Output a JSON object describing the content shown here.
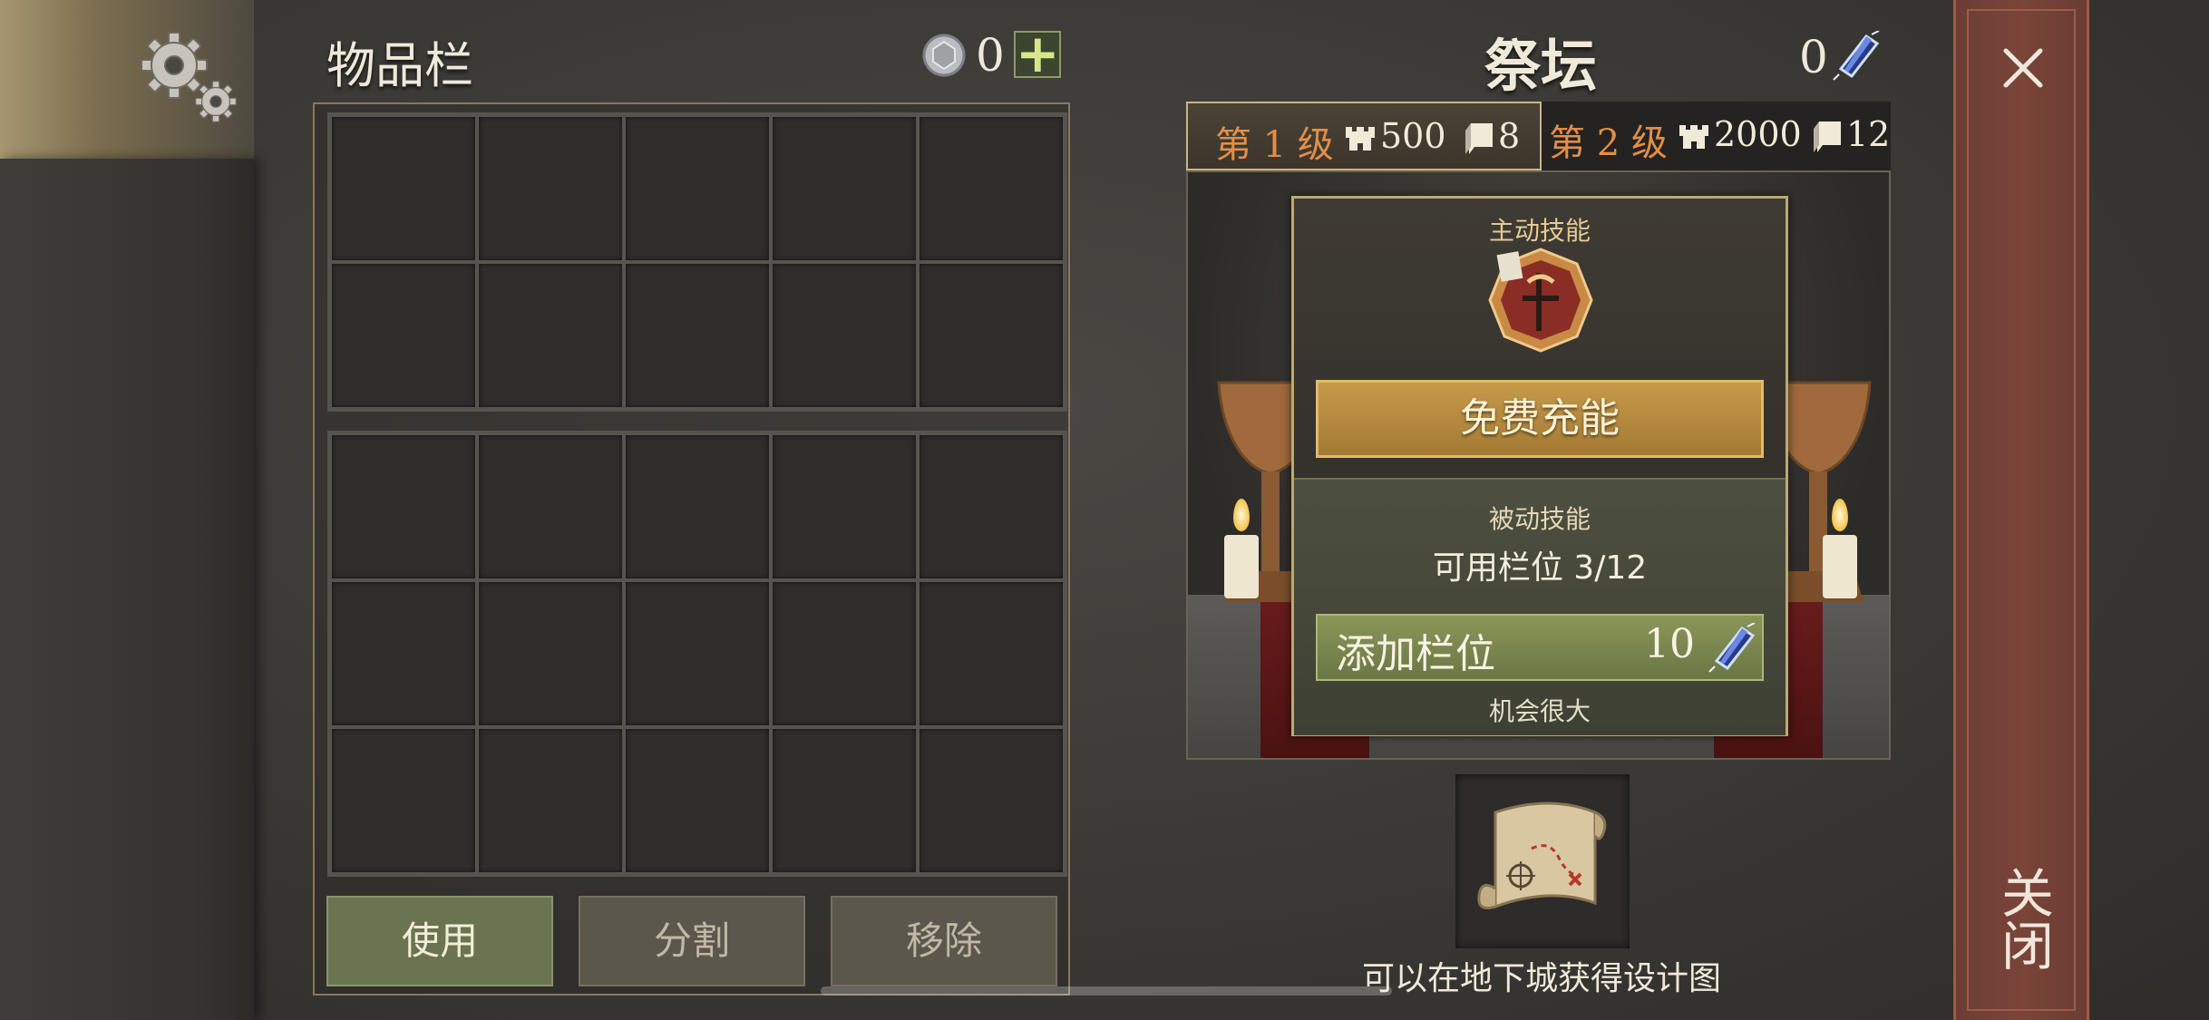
{
  "inventory": {
    "title": "物品栏",
    "silver_count": "0",
    "add_icon": "plus-icon",
    "coin_icon": "silver-coin-icon",
    "buttons": {
      "use": "使用",
      "split": "分割",
      "remove": "移除"
    }
  },
  "altar": {
    "title": "祭坛",
    "crystal_count": "0",
    "crystal_icon": "blue-crystal-icon",
    "levels": [
      {
        "label": "第 1 级",
        "tower_req": "500",
        "book_req": "8"
      },
      {
        "label": "第 2 级",
        "tower_req": "2000",
        "book_req": "12"
      }
    ],
    "active_skill": {
      "label": "主动技能",
      "button": "免费充能"
    },
    "passive_skill": {
      "label": "被动技能",
      "slots_text": "可用栏位 3/12",
      "add_slot_label": "添加栏位",
      "add_slot_cost": "10",
      "chance_text": "机会很大"
    },
    "blueprint_hint": "可以在地下城获得设计图"
  },
  "close": {
    "label": "关闭"
  },
  "colors": {
    "accent_gold": "#c69a4a",
    "level_orange": "#e28e48",
    "use_green": "#6a7450",
    "close_red": "#7a4438"
  }
}
